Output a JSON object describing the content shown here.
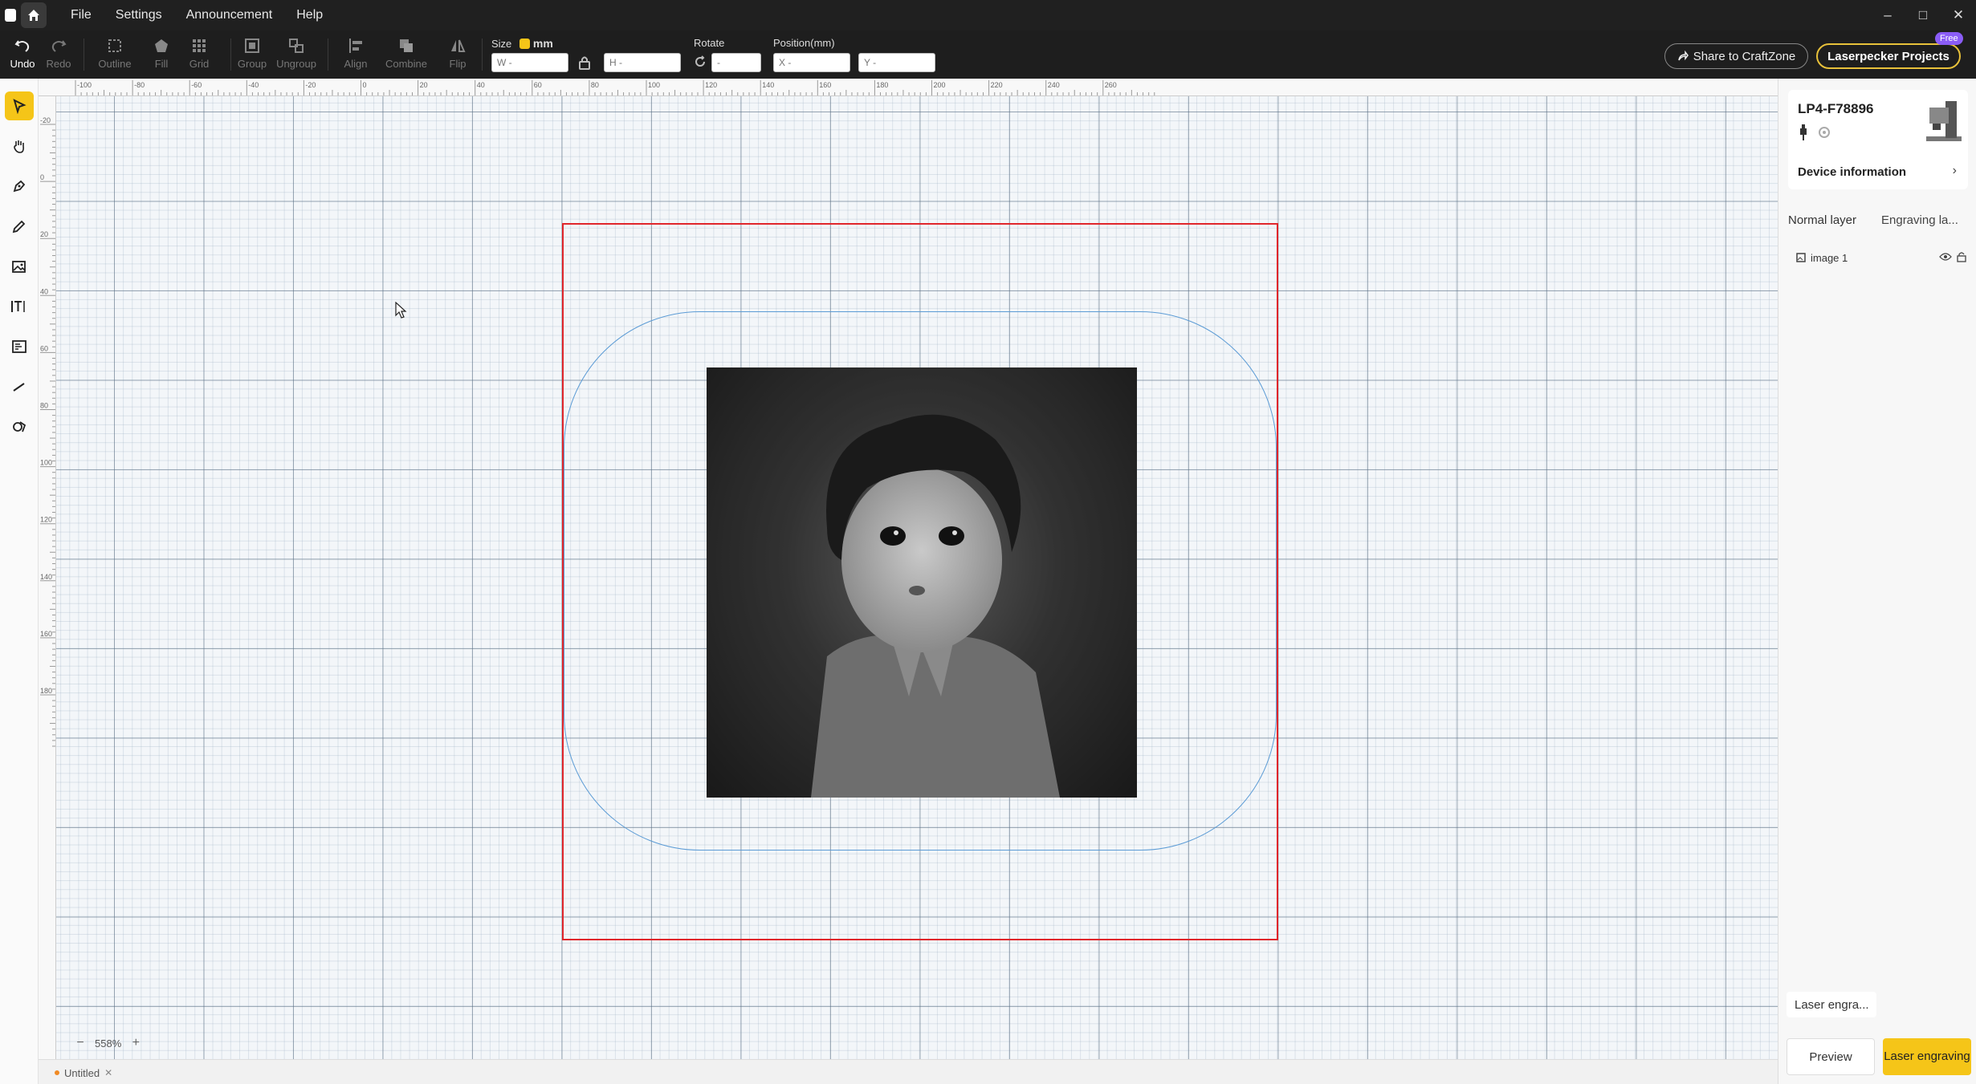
{
  "titlebar": {
    "menu": [
      "File",
      "Settings",
      "Announcement",
      "Help"
    ]
  },
  "toolbar": {
    "undo": "Undo",
    "redo": "Redo",
    "outline": "Outline",
    "fill": "Fill",
    "grid": "Grid",
    "group": "Group",
    "ungroup": "Ungroup",
    "align": "Align",
    "combine": "Combine",
    "flip": "Flip",
    "size_label": "Size",
    "size_unit": "mm",
    "width_placeholder": "W -",
    "height_placeholder": "H -",
    "rotate_label": "Rotate",
    "rotate_placeholder": "-",
    "position_label": "Position(mm)",
    "x_placeholder": "X -",
    "y_placeholder": "Y -",
    "share_button": "Share to CraftZone",
    "projects_button": "Laserpecker Projects",
    "free_badge": "Free"
  },
  "rulers": {
    "horizontal": [
      "-100",
      "-80",
      "-60",
      "-40",
      "-20",
      "0",
      "20",
      "40",
      "60",
      "80",
      "100",
      "120",
      "140",
      "160",
      "180",
      "200",
      "220",
      "240",
      "260"
    ],
    "vertical": [
      "-20",
      "0",
      "20",
      "40",
      "60",
      "80",
      "100",
      "120",
      "140",
      "160",
      "180"
    ]
  },
  "zoom": {
    "level": "558%",
    "minus": "−",
    "plus": "+"
  },
  "doc_tab": {
    "title": "Untitled"
  },
  "right_panel": {
    "device_name": "LP4-F78896",
    "device_info": "Device information",
    "tabs": [
      "Normal layer",
      "Engraving la..."
    ],
    "layers": [
      {
        "name": "image 1"
      }
    ],
    "laser_engrave_tab": "Laser engra...",
    "preview_button": "Preview",
    "engrave_button": "Laser engraving"
  },
  "colors": {
    "accent": "#f5c518",
    "work_area_border": "#e0262b",
    "shape_outline": "#5b9bd5"
  }
}
